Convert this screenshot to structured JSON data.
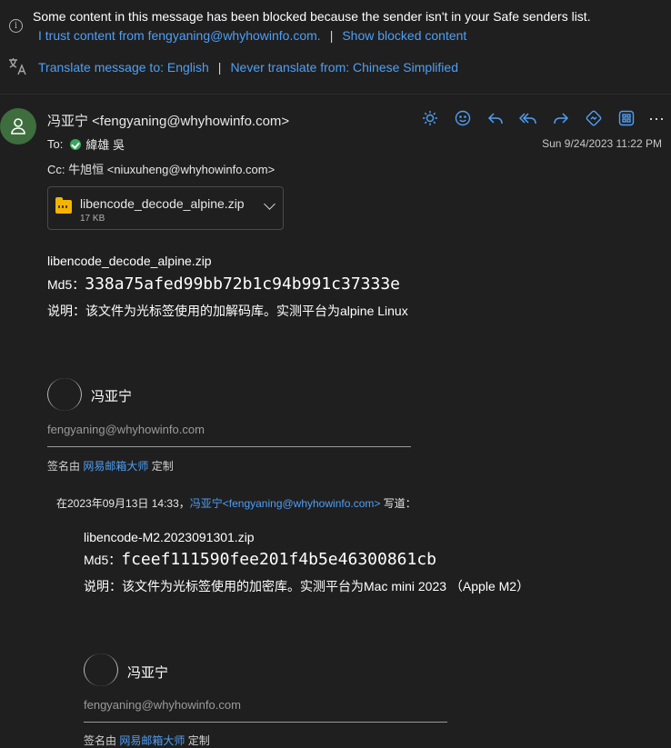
{
  "infobar": {
    "blocked_message": "Some content in this message has been blocked because the sender isn't in your Safe senders list.",
    "trust_link": "I trust content from fengyaning@whyhowinfo.com.",
    "separator": "|",
    "show_blocked_link": "Show blocked content",
    "translate_link": "Translate message to: English",
    "never_translate_link": "Never translate from: Chinese Simplified"
  },
  "header": {
    "from": "冯亚宁 <fengyaning@whyhowinfo.com>",
    "to_label": "To:",
    "to_name": "緯雄 吳",
    "cc_label": "Cc:",
    "cc_value": "牛旭恒 <niuxuheng@whyhowinfo.com>",
    "timestamp": "Sun 9/24/2023 11:22 PM"
  },
  "toolbar": {
    "icons": [
      "sun-icon",
      "emoji-icon",
      "reply-icon",
      "reply-all-icon",
      "forward-icon",
      "teams-share-icon",
      "apps-icon",
      "more-icon"
    ]
  },
  "attachment": {
    "name": "libencode_decode_alpine.zip",
    "size": "17 KB"
  },
  "body": {
    "filename": "libencode_decode_alpine.zip",
    "md5_label": "Md5：",
    "md5_value": "338a75afed99bb72b1c94b991c37333e",
    "description": "说明：该文件为光标签使用的加解码库。实测平台为alpine Linux"
  },
  "signature": {
    "name": "冯亚宁",
    "email": "fengyaning@whyhowinfo.com",
    "credit_prefix": "签名由 ",
    "credit_link": "网易邮箱大师",
    "credit_suffix": " 定制"
  },
  "quoted": {
    "header_prefix": "在2023年09月13日 14:33，",
    "header_link": "冯亚宁<fengyaning@whyhowinfo.com>",
    "header_suffix": " 写道：",
    "filename": "libencode-M2.2023091301.zip",
    "md5_label": "Md5：",
    "md5_value": "fceef111590fee201f4b5e46300861cb",
    "description": "说明：该文件为光标签使用的加密库。实测平台为Mac mini 2023 （Apple M2）",
    "signature": {
      "name": "冯亚宁",
      "email": "fengyaning@whyhowinfo.com",
      "credit_prefix": "签名由 ",
      "credit_link": "网易邮箱大师",
      "credit_suffix": " 定制"
    }
  }
}
